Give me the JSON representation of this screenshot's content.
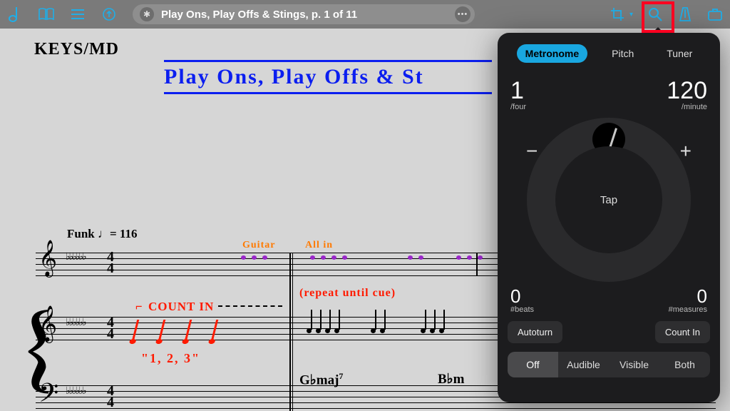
{
  "toolbar": {
    "title": "Play Ons, Play Offs & Stings, p. 1 of 11"
  },
  "score": {
    "part": "KEYS/MD",
    "title": "Play Ons, Play Offs & St",
    "tempo": "Funk ♩= 116",
    "guitar": "Guitar",
    "allin": "All in",
    "repeat": "(repeat until cue)",
    "countin": "COUNT IN",
    "countnums": "\"1,   2,   3\"",
    "chord_gb": "G♭maj",
    "chord_gb_ext": "7",
    "chord_bb": "B♭m",
    "timesig_top": "4",
    "timesig_bot": "4",
    "flats": "♭♭♭♭♭♭"
  },
  "panel": {
    "tabs": {
      "metronome": "Metronome",
      "pitch": "Pitch",
      "tuner": "Tuner"
    },
    "beats_value": "1",
    "beats_label": "/four",
    "bpm_value": "120",
    "bpm_label": "/minute",
    "tap": "Tap",
    "minus": "−",
    "plus": "+",
    "nbeats_value": "0",
    "nbeats_label": "#beats",
    "nmeas_value": "0",
    "nmeas_label": "#measures",
    "autoturn": "Autoturn",
    "countin": "Count In",
    "modes": {
      "off": "Off",
      "audible": "Audible",
      "visible": "Visible",
      "both": "Both"
    }
  }
}
